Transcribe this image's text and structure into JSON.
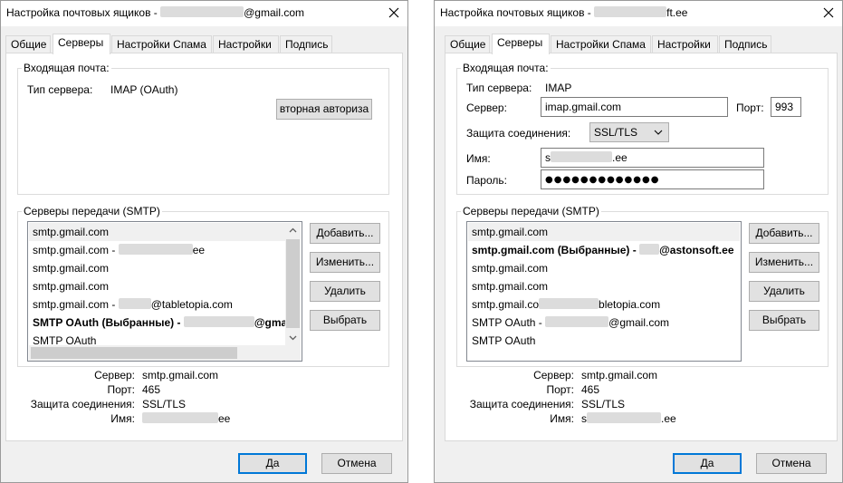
{
  "dialogs": [
    {
      "title": "Настройка почтовых ящиков -",
      "title_suffix": "@gmail.com",
      "tabs": [
        "Общие",
        "Серверы",
        "Настройки Спама",
        "Настройки",
        "Подпись"
      ],
      "incoming": {
        "group_label": "Входящая почта:",
        "server_type_label": "Тип сервера:",
        "server_type_value": "IMAP (OAuth)",
        "reauth_button": "вторная авториза"
      },
      "smtp": {
        "group_label": "Серверы передачи (SMTP)",
        "items": [
          {
            "text": "smtp.gmail.com",
            "suffix": ""
          },
          {
            "text": "smtp.gmail.com -",
            "suffix": "ee"
          },
          {
            "text": "smtp.gmail.com",
            "suffix": ""
          },
          {
            "text": "smtp.gmail.com",
            "suffix": ""
          },
          {
            "text": "smtp.gmail.com -",
            "suffix": "@tabletopia.com"
          },
          {
            "text": "SMTP OAuth (Выбранные) -",
            "suffix": "@gmail"
          },
          {
            "text": "SMTP OAuth",
            "suffix": ""
          }
        ],
        "buttons": {
          "add": "Добавить...",
          "edit": "Изменить...",
          "delete": "Удалить",
          "select": "Выбрать"
        }
      },
      "details": {
        "server_label": "Сервер:",
        "server_value": "smtp.gmail.com",
        "port_label": "Порт:",
        "port_value": "465",
        "security_label": "Защита соединения:",
        "security_value": "SSL/TLS",
        "name_label": "Имя:",
        "name_value": "ee"
      },
      "footer": {
        "ok": "Да",
        "cancel": "Отмена"
      }
    },
    {
      "title": "Настройка почтовых ящиков -",
      "title_suffix": "ft.ee",
      "tabs": [
        "Общие",
        "Серверы",
        "Настройки Спама",
        "Настройки",
        "Подпись"
      ],
      "incoming": {
        "group_label": "Входящая почта:",
        "server_type_label": "Тип сервера:",
        "server_type_value": "IMAP",
        "server_label": "Сервер:",
        "server_value": "imap.gmail.com",
        "port_label": "Порт:",
        "port_value": "993",
        "security_label": "Защита соединения:",
        "security_value": "SSL/TLS",
        "name_label": "Имя:",
        "name_prefix": "s",
        "name_suffix": ".ee",
        "password_label": "Пароль:",
        "password_value": "●●●●●●●●●●●●●"
      },
      "smtp": {
        "group_label": "Серверы передачи (SMTP)",
        "items": [
          {
            "text": "smtp.gmail.com",
            "suffix": ""
          },
          {
            "text": "smtp.gmail.com (Выбранные) -",
            "suffix": "@astonsoft.ee"
          },
          {
            "text": "smtp.gmail.com",
            "suffix": ""
          },
          {
            "text": "smtp.gmail.com",
            "suffix": ""
          },
          {
            "text": "smtp.gmail.co",
            "suffix": "bletopia.com"
          },
          {
            "text": "SMTP OAuth -",
            "suffix": "@gmail.com"
          },
          {
            "text": "SMTP OAuth",
            "suffix": ""
          }
        ],
        "buttons": {
          "add": "Добавить...",
          "edit": "Изменить...",
          "delete": "Удалить",
          "select": "Выбрать"
        }
      },
      "details": {
        "server_label": "Сервер:",
        "server_value": "smtp.gmail.com",
        "port_label": "Порт:",
        "port_value": "465",
        "security_label": "Защита соединения:",
        "security_value": "SSL/TLS",
        "name_label": "Имя:",
        "name_prefix": "s",
        "name_value": ".ee"
      },
      "footer": {
        "ok": "Да",
        "cancel": "Отмена"
      }
    }
  ]
}
